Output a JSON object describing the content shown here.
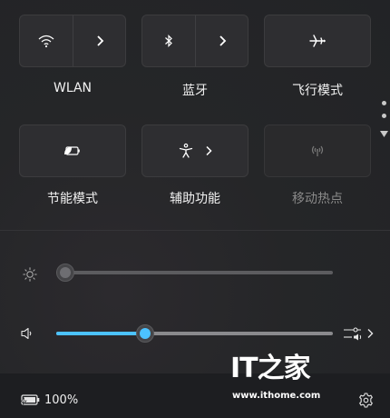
{
  "quick_settings": {
    "tiles": [
      {
        "id": "wlan",
        "label": "WLAN",
        "icon": "wifi-icon",
        "has_expand": true,
        "enabled": true
      },
      {
        "id": "bluetooth",
        "label": "蓝牙",
        "icon": "bluetooth-icon",
        "has_expand": true,
        "enabled": true
      },
      {
        "id": "airplane",
        "label": "飞行模式",
        "icon": "airplane-icon",
        "has_expand": false,
        "enabled": true
      },
      {
        "id": "battery_saver",
        "label": "节能模式",
        "icon": "battery-saver-icon",
        "has_expand": false,
        "enabled": true
      },
      {
        "id": "accessibility",
        "label": "辅助功能",
        "icon": "accessibility-icon",
        "has_expand": true,
        "enabled": true
      },
      {
        "id": "hotspot",
        "label": "移动热点",
        "icon": "hotspot-icon",
        "has_expand": false,
        "enabled": false
      }
    ],
    "pages": {
      "count": 2,
      "current": 1
    }
  },
  "sliders": {
    "brightness": {
      "icon": "brightness-icon",
      "value": 0
    },
    "volume": {
      "icon": "speaker-icon",
      "value": 0.32,
      "accent": "#4cc2ff",
      "output_icon": "audio-output-icon"
    }
  },
  "watermark": {
    "text": "IT之家",
    "url": "www.ithome.com"
  },
  "footer": {
    "battery_percent": "100%",
    "battery_icon": "battery-charging-icon",
    "settings_icon": "gear-icon"
  }
}
